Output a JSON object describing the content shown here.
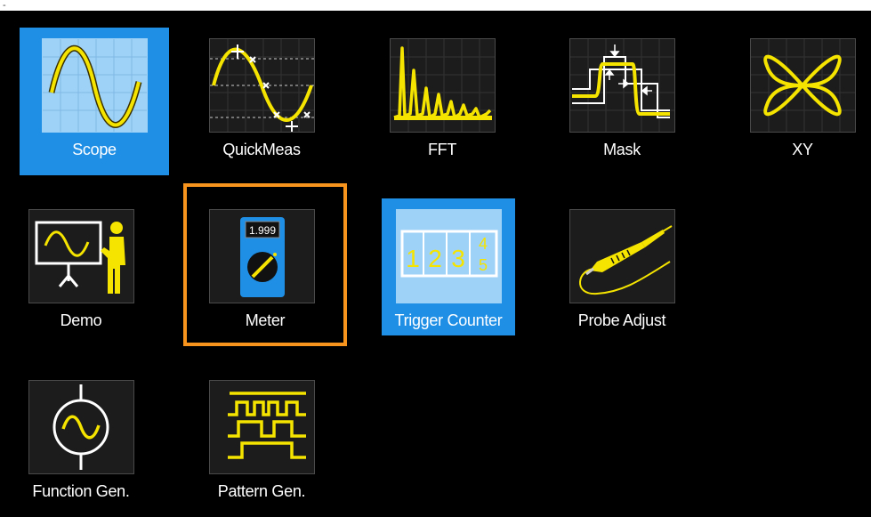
{
  "top_bar": {
    "mark": "-"
  },
  "apps": [
    {
      "id": "scope",
      "label": "Scope",
      "icon": "sine-wave-icon",
      "state": "selected"
    },
    {
      "id": "quickmeas",
      "label": "QuickMeas",
      "icon": "measured-sine-icon",
      "state": "normal"
    },
    {
      "id": "fft",
      "label": "FFT",
      "icon": "spectrum-icon",
      "state": "normal"
    },
    {
      "id": "mask",
      "label": "Mask",
      "icon": "mask-test-icon",
      "state": "normal"
    },
    {
      "id": "xy",
      "label": "XY",
      "icon": "lissajous-icon",
      "state": "normal"
    },
    {
      "id": "demo",
      "label": "Demo",
      "icon": "presenter-icon",
      "state": "normal"
    },
    {
      "id": "meter",
      "label": "Meter",
      "icon": "multimeter-icon",
      "state": "focused",
      "display": "1.999"
    },
    {
      "id": "trigger-counter",
      "label": "Trigger Counter",
      "icon": "counter-digits-icon",
      "state": "selected",
      "digits": [
        "1",
        "2",
        "3",
        "4",
        "5"
      ]
    },
    {
      "id": "probe-adjust",
      "label": "Probe Adjust",
      "icon": "probe-icon",
      "state": "normal"
    },
    {
      "id": "function-gen",
      "label": "Function Gen.",
      "icon": "function-generator-icon",
      "state": "normal"
    },
    {
      "id": "pattern-gen",
      "label": "Pattern Gen.",
      "icon": "pattern-generator-icon",
      "state": "normal"
    }
  ],
  "colors": {
    "selected": "#1f8fe6",
    "focus": "#f7941d",
    "signal": "#f5e400",
    "background": "#000000"
  }
}
